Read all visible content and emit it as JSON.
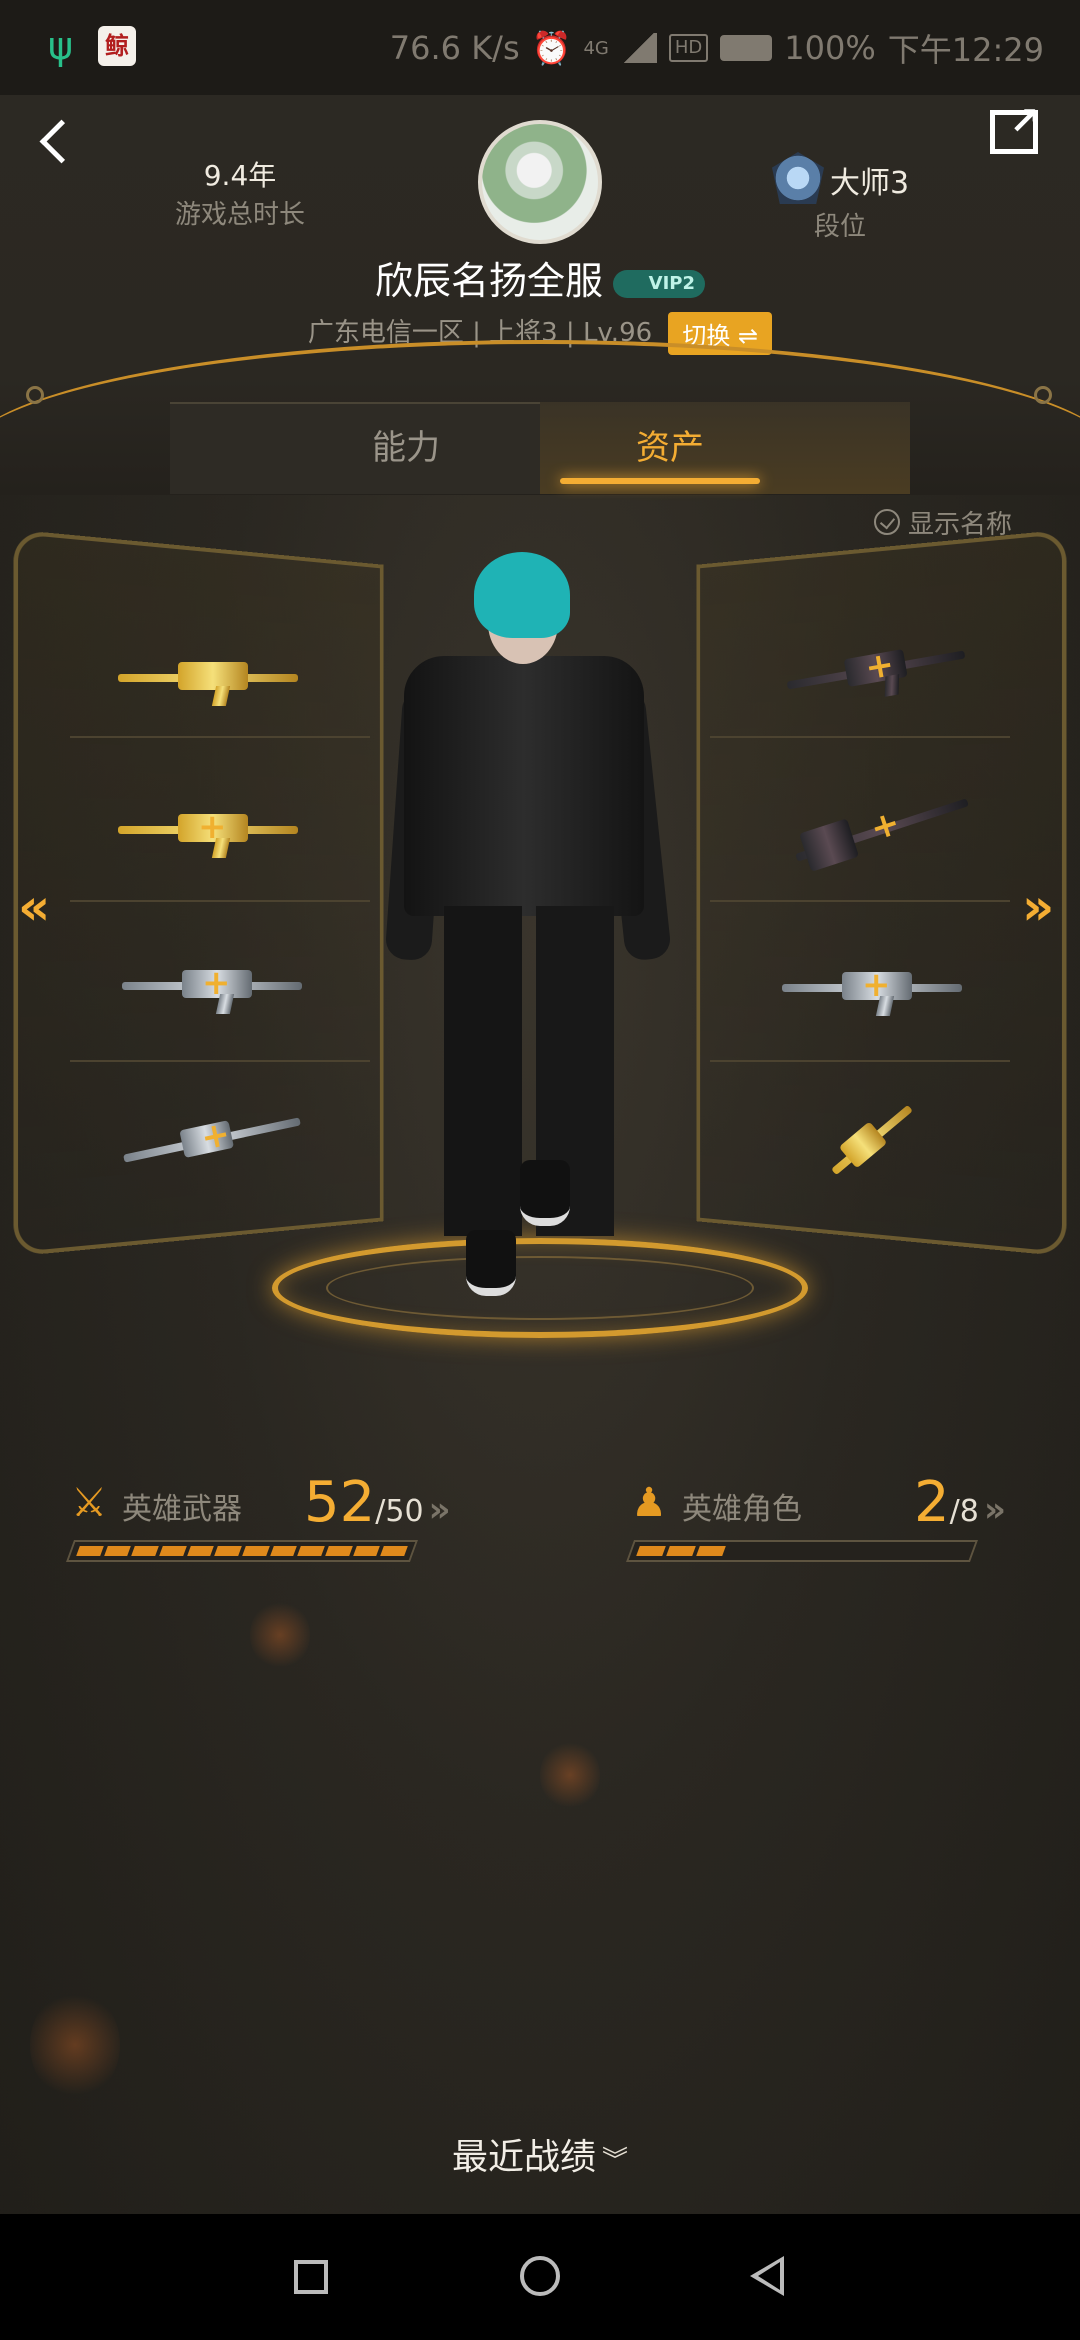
{
  "status_bar": {
    "speed": "76.6 K/s",
    "network": "4G",
    "hd": "HD",
    "battery": "100%",
    "time": "下午12:29"
  },
  "header": {
    "play_years": "9.4年",
    "play_years_label": "游戏总时长",
    "rank_name": "大师3",
    "rank_label": "段位",
    "username": "欣辰名扬全服",
    "vip": "VIP2",
    "server_info": "广东电信一区 | 上将3 | Lv.96",
    "switch_label": "切换 ⇌"
  },
  "tabs": [
    {
      "label": "能力",
      "active": false
    },
    {
      "label": "资产",
      "active": true
    }
  ],
  "show_names_label": "显示名称",
  "weapons_left": [
    "gold-ak",
    "gold-m4",
    "silver-m4",
    "silver-sniper"
  ],
  "weapons_right": [
    "dark-sniper",
    "dark-shovel",
    "silver-rifle",
    "gold-knife"
  ],
  "hero_weapons": {
    "label": "英雄武器",
    "count": "52",
    "total": "/50",
    "segments": 12
  },
  "hero_characters": {
    "label": "英雄角色",
    "count": "2",
    "total": "/8",
    "segments": 3
  },
  "recent_label": "最近战绩",
  "colors": {
    "accent": "#f4ad33",
    "bg": "#2a2721",
    "vip": "#1f6b5f"
  }
}
